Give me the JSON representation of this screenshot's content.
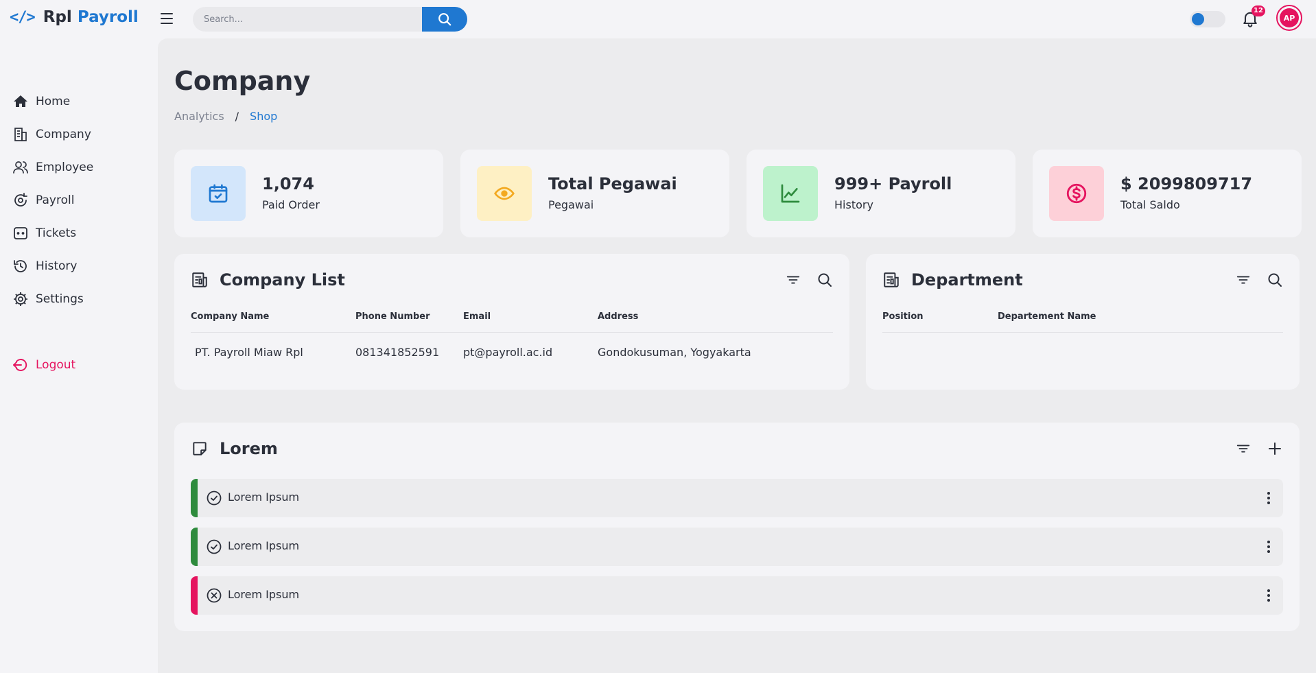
{
  "brand": {
    "icon": "</>",
    "name_part1": "Rpl",
    "name_part2": "Payroll"
  },
  "search": {
    "placeholder": "Search..."
  },
  "notifications": {
    "count": "12"
  },
  "avatar": {
    "initials": "AP"
  },
  "colors": {
    "primary": "#1f78d1",
    "accent": "#e5145f",
    "success": "#2e8b3d"
  },
  "sidebar": {
    "items": [
      {
        "label": "Home",
        "icon": "home-icon"
      },
      {
        "label": "Company",
        "icon": "building-icon"
      },
      {
        "label": "Employee",
        "icon": "users-icon"
      },
      {
        "label": "Payroll",
        "icon": "payroll-icon"
      },
      {
        "label": "Tickets",
        "icon": "ticket-icon"
      },
      {
        "label": "History",
        "icon": "history-icon"
      },
      {
        "label": "Settings",
        "icon": "gear-icon"
      }
    ],
    "logout": {
      "label": "Logout",
      "icon": "logout-icon"
    }
  },
  "page": {
    "title": "Company",
    "breadcrumb": {
      "parent": "Analytics",
      "separator": "/",
      "current": "Shop"
    }
  },
  "stats": [
    {
      "value": "1,074",
      "label": "Paid Order",
      "icon": "calendar-check-icon"
    },
    {
      "value": "Total Pegawai",
      "label": "Pegawai",
      "icon": "eye-icon"
    },
    {
      "value": "999+ Payroll",
      "label": "History",
      "icon": "chart-line-icon"
    },
    {
      "value": "$ 2099809717",
      "label": "Total Saldo",
      "icon": "dollar-icon"
    }
  ],
  "company_list": {
    "title": "Company List",
    "columns": [
      "Company Name",
      "Phone Number",
      "Email",
      "Address"
    ],
    "rows": [
      [
        "PT. Payroll Miaw Rpl",
        "081341852591",
        "pt@payroll.ac.id",
        "Gondokusuman, Yogyakarta"
      ]
    ]
  },
  "department": {
    "title": "Department",
    "columns": [
      "Position",
      "Departement Name"
    ]
  },
  "lorem": {
    "title": "Lorem",
    "items": [
      {
        "text": "Lorem Ipsum",
        "status": "done"
      },
      {
        "text": "Lorem Ipsum",
        "status": "done"
      },
      {
        "text": "Lorem Ipsum",
        "status": "cancelled"
      }
    ]
  }
}
